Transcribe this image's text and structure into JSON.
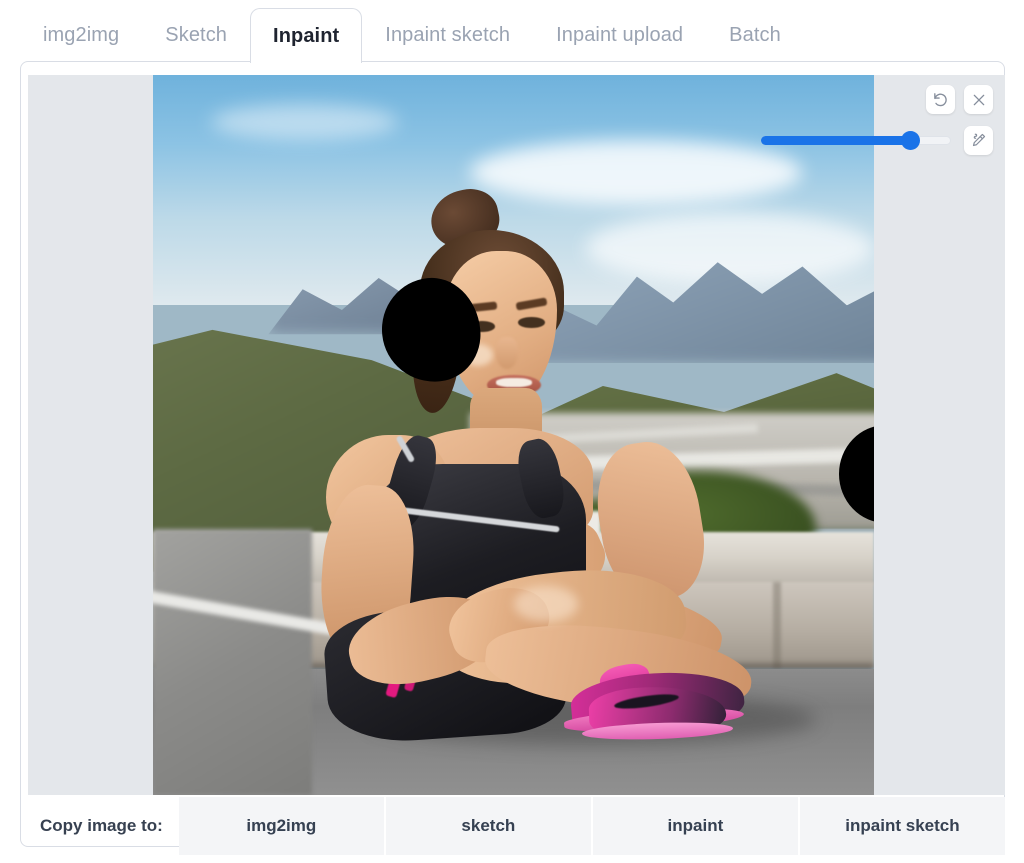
{
  "tabs": [
    {
      "label": "img2img",
      "active": false
    },
    {
      "label": "Sketch",
      "active": false
    },
    {
      "label": "Inpaint",
      "active": true
    },
    {
      "label": "Inpaint sketch",
      "active": false
    },
    {
      "label": "Inpaint upload",
      "active": false
    },
    {
      "label": "Batch",
      "active": false
    }
  ],
  "toolbar": {
    "undo_icon": "undo-icon",
    "close_icon": "close-icon",
    "brush_icon": "brush-icon"
  },
  "brush_slider": {
    "name": "brush-size-slider",
    "value_percent": 77,
    "accent_color": "#1a73e8",
    "track_color": "#f1f3f6"
  },
  "canvas": {
    "background_color": "#e4e7eb",
    "image_description": "Smiling woman in black athletic tank top and black shorts with pink stripes sitting on a roadside concrete barrier, pink and purple running shoes, blurred green mountain valley background under a blue sky",
    "mask_color": "#000000",
    "masks": [
      {
        "name": "mask-blob-chest"
      },
      {
        "name": "mask-blob-right-edge"
      }
    ]
  },
  "copy_bar": {
    "label": "Copy image to:",
    "buttons": [
      {
        "label": "img2img"
      },
      {
        "label": "sketch"
      },
      {
        "label": "inpaint"
      },
      {
        "label": "inpaint sketch"
      }
    ]
  }
}
